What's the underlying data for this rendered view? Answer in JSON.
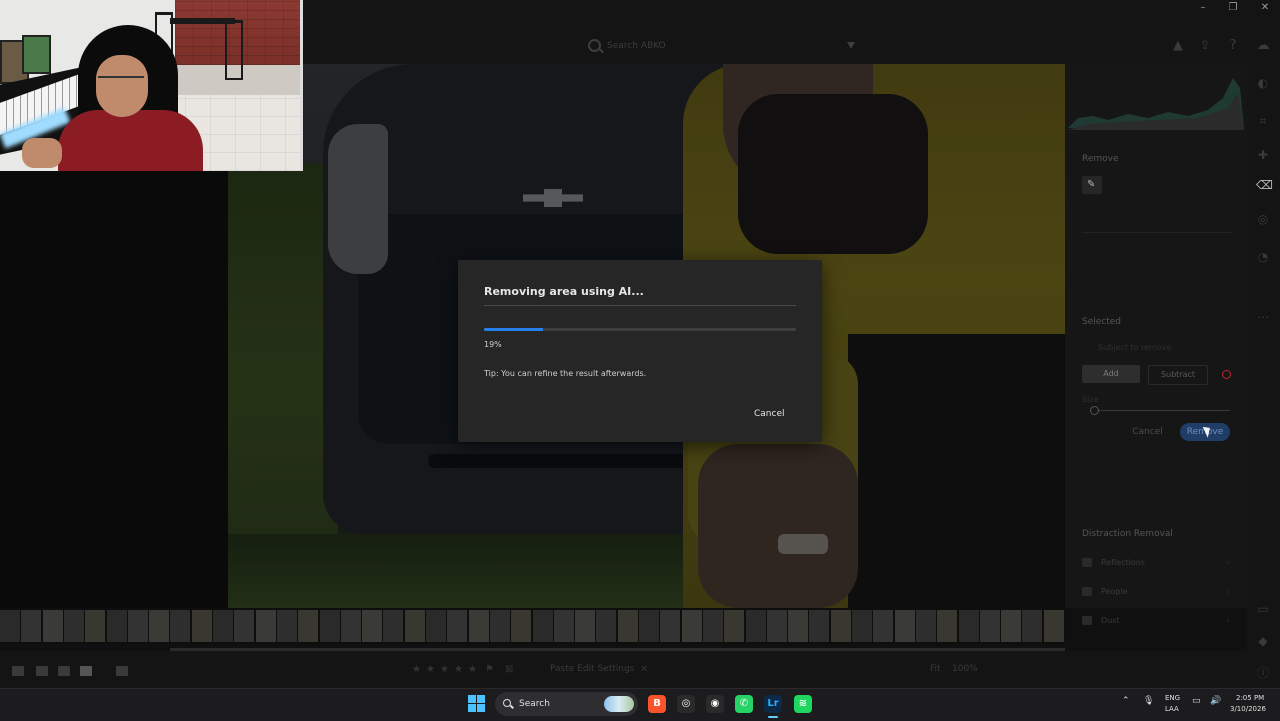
{
  "window": {
    "minimize": "–",
    "maximize": "❐",
    "close": "✕"
  },
  "topbar": {
    "search_placeholder": "Search ABKO"
  },
  "dialog": {
    "title": "Removing area using AI...",
    "progress_label": "19%",
    "progress_value": 0.19,
    "tip": "Tip: You can refine the result afterwards.",
    "cancel_label": "Cancel",
    "accent": "#2680eb"
  },
  "right_panel": {
    "remove_heading": "Remove",
    "selected_heading": "Selected",
    "select_option": "Subject to remove",
    "add_label": "Add",
    "subtract_label": "Subtract",
    "size_label": "Size",
    "cancel_label": "Cancel",
    "remove_button": "Remove",
    "distraction_heading": "Distraction Removal",
    "distraction_items": [
      {
        "label": "Reflections",
        "icon": "reflections-icon"
      },
      {
        "label": "People",
        "icon": "people-icon"
      },
      {
        "label": "Dust",
        "icon": "dust-icon"
      }
    ]
  },
  "bottom_bar": {
    "paste_edit": "Paste Edit Settings",
    "fit": "Fit",
    "zoom": "100%"
  },
  "taskbar": {
    "search_label": "Search",
    "apps": [
      {
        "name": "brave",
        "icon": "brave-icon",
        "color": "#fb542b",
        "glyph": "B"
      },
      {
        "name": "chatgpt",
        "icon": "chatgpt-icon",
        "color": "#2a2a2a",
        "glyph": "◎"
      },
      {
        "name": "obs",
        "icon": "obs-icon",
        "color": "#2a2a2a",
        "glyph": "◉"
      },
      {
        "name": "whatsapp",
        "icon": "whatsapp-icon",
        "color": "#25d366",
        "glyph": "✆"
      },
      {
        "name": "lightroom",
        "icon": "lightroom-icon",
        "color": "#0b2a47",
        "glyph": "Lr"
      },
      {
        "name": "spotify",
        "icon": "spotify-icon",
        "color": "#1ed760",
        "glyph": "≋"
      }
    ],
    "lang_line1": "ENG",
    "lang_line2": "LAA",
    "time": "2:05 PM",
    "date": "3/10/2026"
  }
}
